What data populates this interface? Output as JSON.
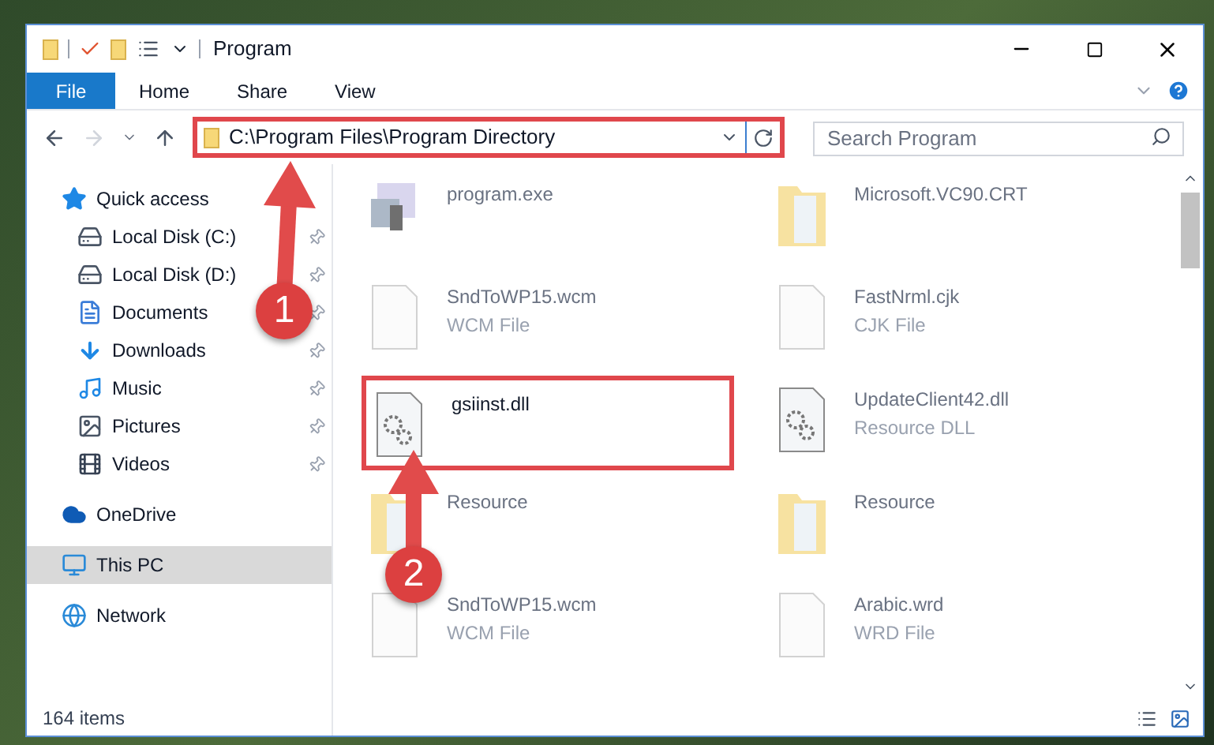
{
  "window": {
    "title": "Program"
  },
  "ribbon_tabs": [
    {
      "label": "File",
      "selected": true
    },
    {
      "label": "Home",
      "selected": false
    },
    {
      "label": "Share",
      "selected": false
    },
    {
      "label": "View",
      "selected": false
    }
  ],
  "address_bar": {
    "value": "C:\\Program Files\\Program Directory",
    "highlighted": true
  },
  "search": {
    "placeholder": "Search Program"
  },
  "nav": [
    {
      "label": "Quick access",
      "kind": "quick",
      "selected": false,
      "children": [
        {
          "label": "Local Disk (C:)",
          "kind": "disk",
          "pinned": true
        },
        {
          "label": "Local Disk (D:)",
          "kind": "disk",
          "pinned": true
        },
        {
          "label": "Documents",
          "kind": "documents",
          "pinned": true
        },
        {
          "label": "Downloads",
          "kind": "downloads",
          "pinned": true
        },
        {
          "label": "Music",
          "kind": "music",
          "pinned": true
        },
        {
          "label": "Pictures",
          "kind": "pictures",
          "pinned": true
        },
        {
          "label": "Videos",
          "kind": "videos",
          "pinned": true
        }
      ]
    },
    {
      "label": "OneDrive",
      "kind": "cloud",
      "selected": false
    },
    {
      "label": "This PC",
      "kind": "pc",
      "selected": true
    },
    {
      "label": "Network",
      "kind": "network",
      "selected": false
    }
  ],
  "files": [
    {
      "name": "program.exe",
      "kind": "exe",
      "highlighted": false
    },
    {
      "name": "Microsoft.VC90.CRT",
      "kind": "folder",
      "highlighted": false
    },
    {
      "name": "SndToWP15.wcm",
      "type": "WCM File",
      "kind": "file",
      "highlighted": false
    },
    {
      "name": "FastNrml.cjk",
      "type": "CJK File",
      "kind": "file",
      "highlighted": false
    },
    {
      "name": "gsiinst.dll",
      "kind": "dll",
      "highlighted": true
    },
    {
      "name": "UpdateClient42.dll",
      "type": "Resource DLL",
      "kind": "dll",
      "highlighted": false
    },
    {
      "name": "Resource",
      "kind": "folder",
      "highlighted": false
    },
    {
      "name": "Resource",
      "kind": "folder",
      "highlighted": false
    },
    {
      "name": "SndToWP15.wcm",
      "type": "WCM File",
      "kind": "file",
      "highlighted": false
    },
    {
      "name": "Arabic.wrd",
      "type": "WRD File",
      "kind": "file",
      "highlighted": false
    }
  ],
  "status_bar": {
    "count": "164 items"
  },
  "callouts": [
    {
      "label": "1"
    },
    {
      "label": "2"
    }
  ]
}
